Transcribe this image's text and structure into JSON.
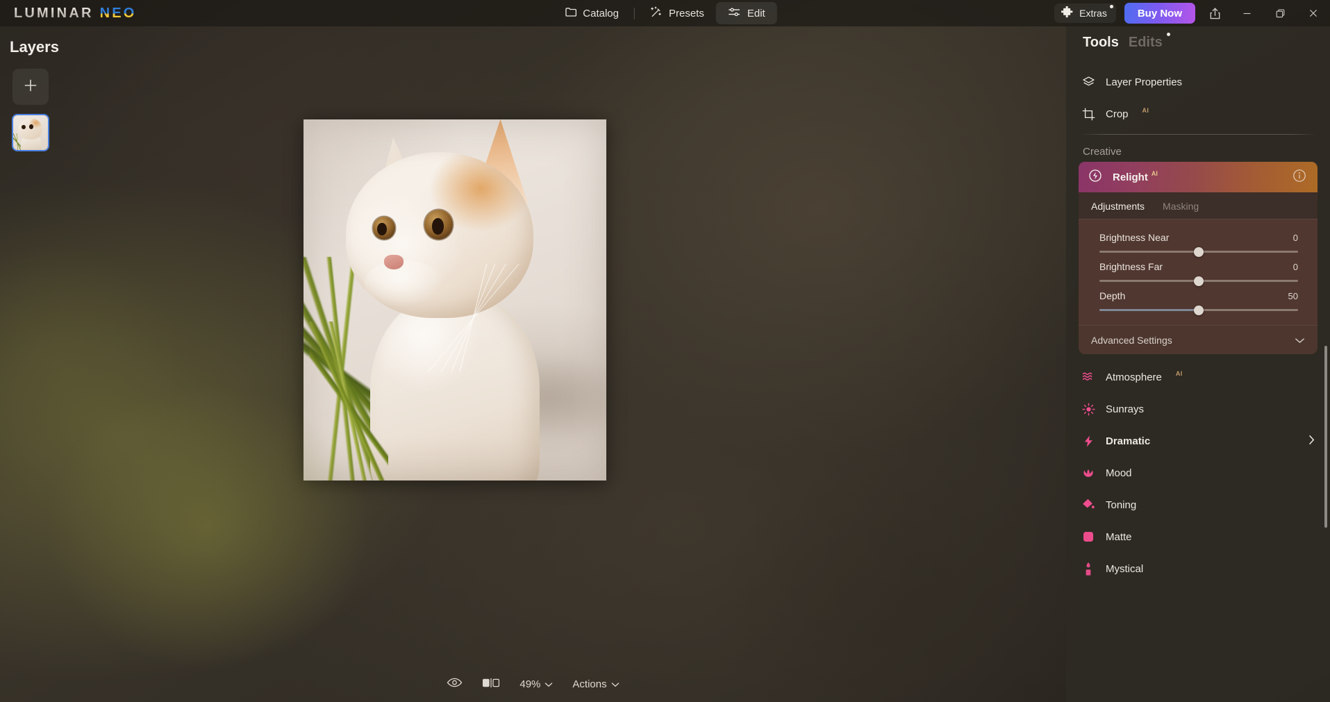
{
  "app": {
    "logo_primary": "LUMINAR",
    "logo_accent": "NEO"
  },
  "topnav": {
    "items": [
      {
        "label": "Catalog",
        "icon": "folder-icon",
        "active": false
      },
      {
        "label": "Presets",
        "icon": "magic-wand-icon",
        "active": false
      },
      {
        "label": "Edit",
        "icon": "sliders-icon",
        "active": true
      }
    ]
  },
  "window_controls": {
    "extras_label": "Extras",
    "buy_now_label": "Buy Now",
    "share_icon": "share-icon",
    "minimize_icon": "minimize-icon",
    "maximize_icon": "maximize-icon",
    "close_icon": "close-icon",
    "buy_now_gradient_from": "#4f6df0",
    "buy_now_gradient_to": "#b455e8"
  },
  "layers": {
    "title": "Layers",
    "add_label": "+",
    "thumbnail_selected": true,
    "selection_color": "#4a7fe0"
  },
  "right_panel": {
    "tabs": [
      {
        "label": "Tools",
        "active": true,
        "badge": false
      },
      {
        "label": "Edits",
        "active": false,
        "badge": true
      }
    ],
    "top_tools": [
      {
        "label": "Layer Properties",
        "icon": "layers-icon",
        "ai": ""
      },
      {
        "label": "Crop",
        "icon": "crop-icon",
        "ai": "AI"
      }
    ],
    "section_label": "Creative",
    "active_module": {
      "name": "Relight",
      "ai": "AI",
      "icon": "relight-icon",
      "info_icon": "info-icon",
      "gradient_from": "#8a3568",
      "gradient_to": "#ad6b26",
      "tabs": [
        {
          "label": "Adjustments",
          "active": true
        },
        {
          "label": "Masking",
          "active": false
        }
      ],
      "sliders": [
        {
          "label": "Brightness Near",
          "value": "0",
          "percent": 50,
          "fill_percent": 0
        },
        {
          "label": "Brightness Far",
          "value": "0",
          "percent": 50,
          "fill_percent": 0
        },
        {
          "label": "Depth",
          "value": "50",
          "percent": 50,
          "fill_percent": 50
        }
      ],
      "advanced_label": "Advanced Settings",
      "advanced_chevron": "chevron-down-icon"
    },
    "creative_tools": [
      {
        "label": "Atmosphere",
        "ai": "AI",
        "icon": "atmosphere-icon",
        "chevron": false,
        "highlight": false
      },
      {
        "label": "Sunrays",
        "ai": "",
        "icon": "sunrays-icon",
        "chevron": false,
        "highlight": false
      },
      {
        "label": "Dramatic",
        "ai": "",
        "icon": "dramatic-icon",
        "chevron": true,
        "highlight": true
      },
      {
        "label": "Mood",
        "ai": "",
        "icon": "mood-icon",
        "chevron": false,
        "highlight": false
      },
      {
        "label": "Toning",
        "ai": "",
        "icon": "toning-icon",
        "chevron": false,
        "highlight": false
      },
      {
        "label": "Matte",
        "ai": "",
        "icon": "matte-icon",
        "chevron": false,
        "highlight": false
      },
      {
        "label": "Mystical",
        "ai": "",
        "icon": "mystical-icon",
        "chevron": false,
        "highlight": false
      }
    ],
    "accent_pink": "#ef4d8e"
  },
  "bottom_bar": {
    "items": [
      {
        "label": "",
        "icon": "eye-icon"
      },
      {
        "label": "",
        "icon": "compare-icon"
      },
      {
        "label": "49%",
        "icon": "chevron-down-icon"
      },
      {
        "label": "Actions",
        "icon": "chevron-down-icon"
      }
    ],
    "zoom_level": "49%",
    "actions_label": "Actions"
  }
}
